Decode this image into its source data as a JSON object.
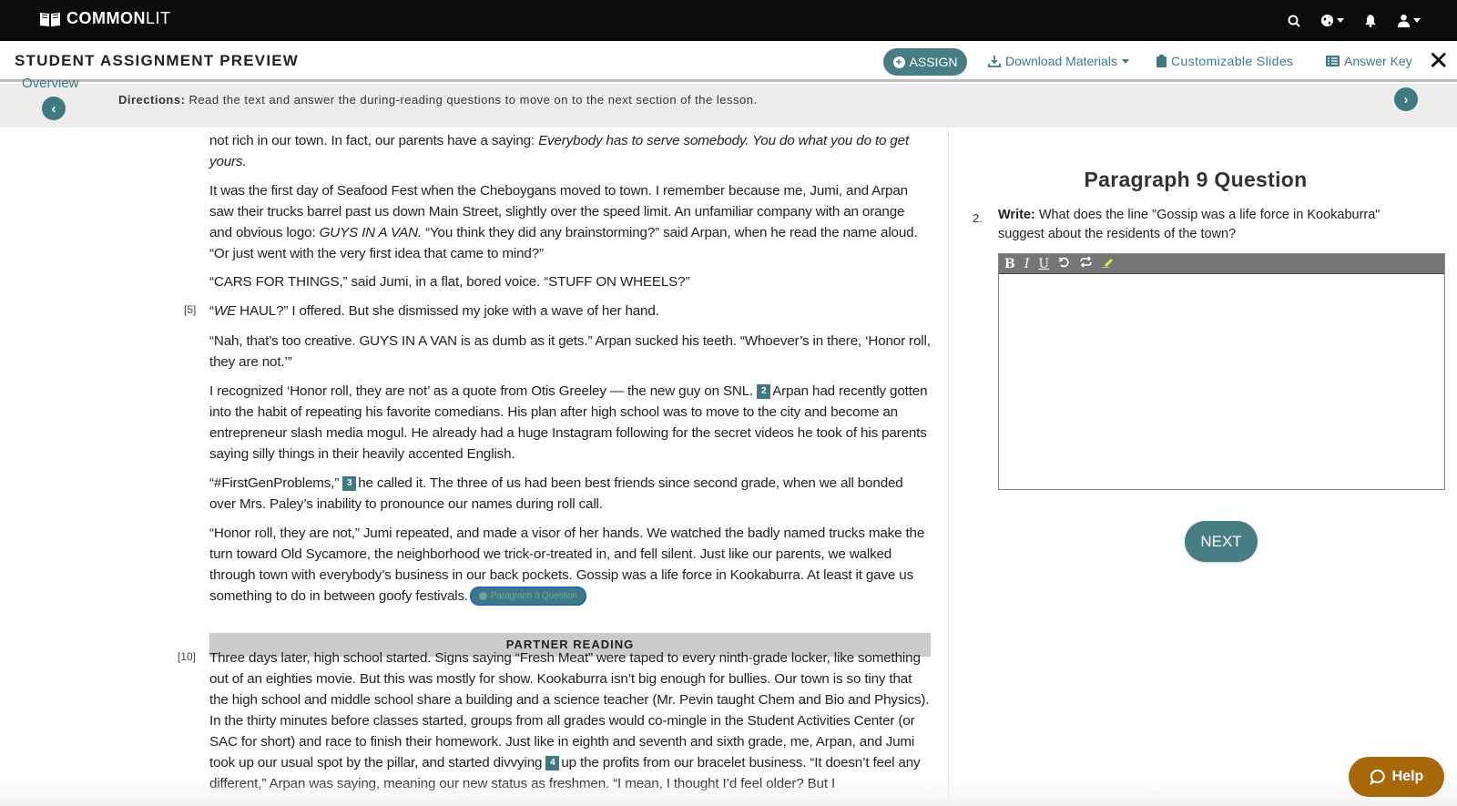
{
  "topbar": {
    "logo_bold": "COMMON",
    "logo_light": "LIT",
    "icons": [
      "search-icon",
      "globe-icon",
      "bell-icon",
      "user-icon"
    ]
  },
  "header": {
    "title": "STUDENT ASSIGNMENT PREVIEW",
    "assign_label": "ASSIGN",
    "download_label": "Download Materials",
    "slides_label": "Customizable Slides",
    "answer_key_label": "Answer Key"
  },
  "directions_bar": {
    "overview_label": "Overview",
    "directions_label": "Directions:",
    "directions_text": " Read the text and answer the during-reading questions to move on to the next section of the lesson."
  },
  "reading": {
    "p1": {
      "text": "not rich in our town. In fact, our parents have a saying: ",
      "italic": "Everybody has to serve somebody. You do what you do to get yours."
    },
    "p2": {
      "a": "It was the first day of Seafood Fest when the Cheboygans moved to town. I remember because me, Jumi, and Arpan saw their trucks barrel past us down Main Street, slightly over the speed limit. An unfamiliar company with an orange and obvious logo: ",
      "italic": "GUYS IN A VAN.",
      "b": " “You think they did any brainstorming?” said Arpan, when he read the name aloud. “Or just went with the very first idea that came to mind?”"
    },
    "p3": "“CARS FOR THINGS,” said Jumi, in a flat, bored voice. “STUFF ON WHEELS?”",
    "p4": {
      "num": "[5]",
      "a": "“",
      "italic": "WE",
      "b": " HAUL?” I offered. But she dismissed my joke with a wave of her hand."
    },
    "p5": "“Nah, that’s too creative. GUYS IN A VAN is as dumb as it gets.” Arpan sucked his teeth. “Whoever’s in there, ‘Honor roll, they are not.’”",
    "p6": {
      "a": "I recognized ‘Honor roll, they are not’ as a quote from Otis Greeley — the new guy on SNL. ",
      "marker": "2",
      "b": "Arpan had recently gotten into the habit of repeating his favorite comedians. His plan after high school was to move to the city and become an entrepreneur slash media mogul. He already had a huge Instagram following for the secret videos he took of his parents saying silly things in their heavily accented English."
    },
    "p7": {
      "a": "“#FirstGenProblems,” ",
      "marker": "3",
      "b": "he called it. The three of us had been best friends since second grade, when we all bonded over Mrs. Paley’s inability to pronounce our names during roll call."
    },
    "p8": {
      "a": "“Honor roll, they are not,” Jumi repeated, and made a visor of her hands. We watched the badly named trucks make the turn toward Old Sycamore, the neighborhood we trick-or-treated in, and fell silent. Just like our parents, we walked through town with everybody’s business in our back pockets. Gossip was a life force in Kookaburra. At least it gave us something to do in between goofy festivals.",
      "pill": "Paragraph 9 Question"
    },
    "section_label": "PARTNER READING",
    "p9": {
      "num": "[10]",
      "a": "Three days later, high school started. Signs saying “Fresh Meat” were taped to every ninth-grade locker, like something out of an eighties movie. But this was mostly for show. Kookaburra isn’t big enough for bullies. Our town is so tiny that the high school and middle school share a building and a science teacher (Mr. Pevin taught Chem and Bio and Physics). In the thirty minutes before classes started, groups from all grades would co-mingle in the Student Activities Center (or SAC for short) and race to finish their homework. Just like in eighth and seventh and sixth grade, me, Arpan, and Jumi took up our usual spot by the pillar, and started divvying ",
      "marker": "4",
      "b": "up the profits from our bracelet business. “It doesn’t feel any different,” Arpan was saying, meaning our new status as freshmen. “I mean, I thought I’d feel older? But I"
    }
  },
  "question": {
    "title": "Paragraph 9 Question",
    "number": "2.",
    "prompt_label": "Write:",
    "prompt_text": " What does the line \"Gossip was a life force in Kookaburra\" suggest about the residents of the town?",
    "toolbar": [
      "B",
      "I",
      "U",
      "undo",
      "redo",
      "highlight"
    ],
    "answer_value": "",
    "next_label": "NEXT"
  },
  "help": {
    "label": "Help"
  },
  "colors": {
    "accent": "#477e84",
    "help": "#a8680a",
    "topbar": "#0b0b0b",
    "highlight": "#f2e34c"
  }
}
